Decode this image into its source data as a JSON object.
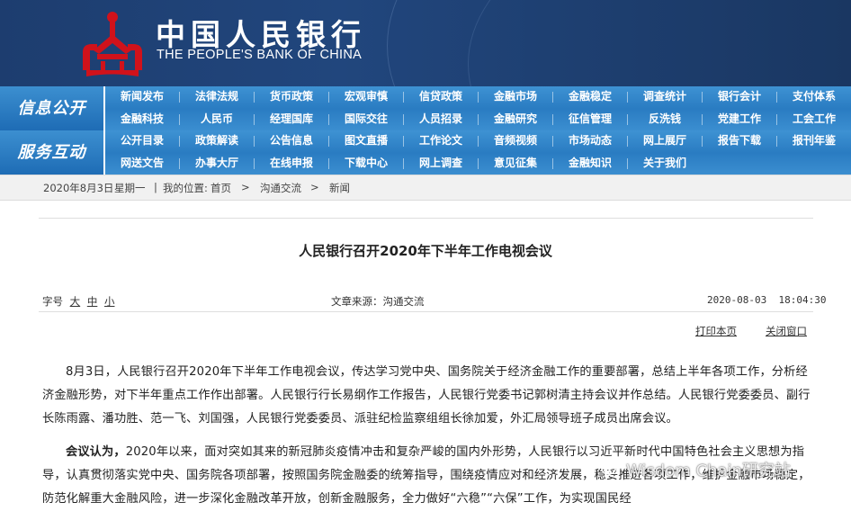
{
  "header": {
    "title_cn": "中国人民银行",
    "title_en": "THE PEOPLE'S BANK OF CHINA",
    "colors": {
      "banner": "#21467d",
      "logo_red": "#d0121b",
      "nav_blue": "#2a7cc2"
    }
  },
  "nav": {
    "rows": [
      {
        "title": "信息公开",
        "links": [
          [
            "新闻发布",
            "法律法规",
            "货币政策",
            "宏观审慎",
            "信贷政策",
            "金融市场",
            "金融稳定",
            "调查统计",
            "银行会计",
            "支付体系"
          ],
          [
            "金融科技",
            "人民币",
            "经理国库",
            "国际交往",
            "人员招录",
            "金融研究",
            "征信管理",
            "反洗钱",
            "党建工作",
            "工会工作"
          ]
        ]
      },
      {
        "title": "服务互动",
        "links": [
          [
            "公开目录",
            "政策解读",
            "公告信息",
            "图文直播",
            "工作论文",
            "音频视频",
            "市场动态",
            "网上展厅",
            "报告下载",
            "报刊年鉴"
          ],
          [
            "网送文告",
            "办事大厅",
            "在线申报",
            "下载中心",
            "网上调查",
            "意见征集",
            "金融知识",
            "关于我们"
          ]
        ]
      }
    ]
  },
  "breadcrumb": {
    "date": "2020年8月3日",
    "weekday": "星期一",
    "sep": "|",
    "location_label": "我的位置:",
    "items": [
      "首页",
      "沟通交流",
      "新闻"
    ],
    "arrow": ">"
  },
  "article": {
    "title": "人民银行召开2020年下半年工作电视会议",
    "font_size_label": "字号",
    "font_sizes": [
      "大",
      "中",
      "小"
    ],
    "source": "文章来源：沟通交流",
    "datetime": "2020-08-03  18:04:30",
    "print_label": "打印本页",
    "close_label": "关闭窗口",
    "paragraphs": [
      {
        "lead": "",
        "text": "8月3日，人民银行召开2020年下半年工作电视会议，传达学习党中央、国务院关于经济金融工作的重要部署，总结上半年各项工作，分析经济金融形势，对下半年重点工作作出部署。人民银行行长易纲作工作报告，人民银行党委书记郭树清主持会议并作总结。人民银行党委委员、副行长陈雨露、潘功胜、范一飞、刘国强，人民银行党委委员、派驻纪检监察组组长徐加爱，外汇局领导班子成员出席会议。"
      },
      {
        "lead": "会议认为，",
        "text": "2020年以来，面对突如其来的新冠肺炎疫情冲击和复杂严峻的国内外形势，人民银行以习近平新时代中国特色社会主义思想为指导，认真贯彻落实党中央、国务院各项部署，按照国务院金融委的统筹指导，围绕疫情应对和经济发展，稳妥推进各项工作，维护金融市场稳定，防范化解重大金融风险，进一步深化金融改革开放，创新金融服务，全力做好“六稳”“六保”工作，为实现国民经"
      }
    ]
  },
  "watermark": {
    "text": "Wisdom Chain研究站",
    "icon": "wechat-icon"
  }
}
